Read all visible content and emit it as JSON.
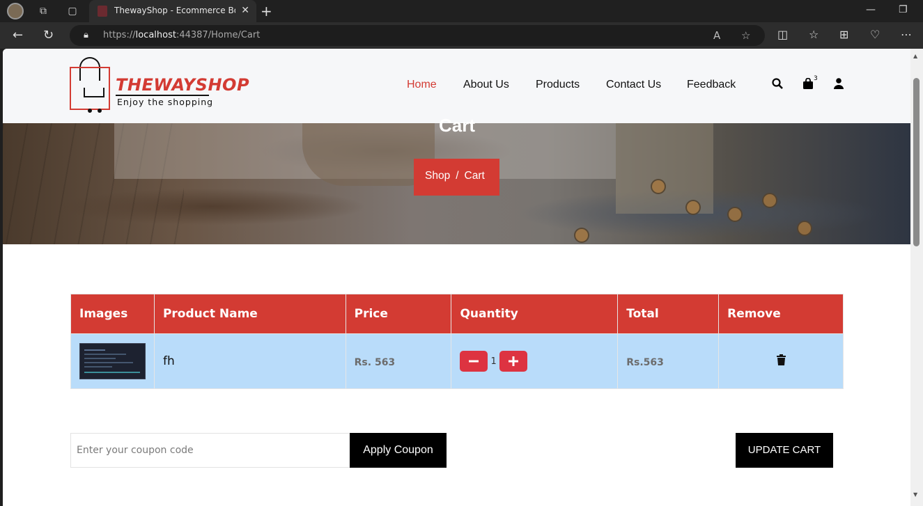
{
  "browser": {
    "tab_title": "ThewayShop - Ecommerce Bootstrap",
    "url_prefix": "https://",
    "url_host": "localhost",
    "url_rest": ":44387/Home/Cart"
  },
  "site": {
    "logo_name": "THEWAYSHOP",
    "logo_tagline": "Enjoy the shopping",
    "nav": [
      "Home",
      "About Us",
      "Products",
      "Contact Us",
      "Feedback"
    ],
    "active_nav": "Home",
    "cart_count": "3"
  },
  "hero": {
    "title": "Cart",
    "breadcrumb": [
      "Shop",
      "Cart"
    ]
  },
  "cart": {
    "columns": [
      "Images",
      "Product Name",
      "Price",
      "Quantity",
      "Total",
      "Remove"
    ],
    "rows": [
      {
        "product_name": "fh",
        "price": "Rs. 563",
        "quantity": "1",
        "total": "Rs.563"
      }
    ]
  },
  "coupon": {
    "placeholder": "Enter your coupon code",
    "apply_label": "Apply Coupon",
    "update_label": "UPDATE CART"
  },
  "colors": {
    "brand": "#d33b33",
    "row_bg": "#b9dcfa",
    "qty_button": "#dd3341"
  }
}
